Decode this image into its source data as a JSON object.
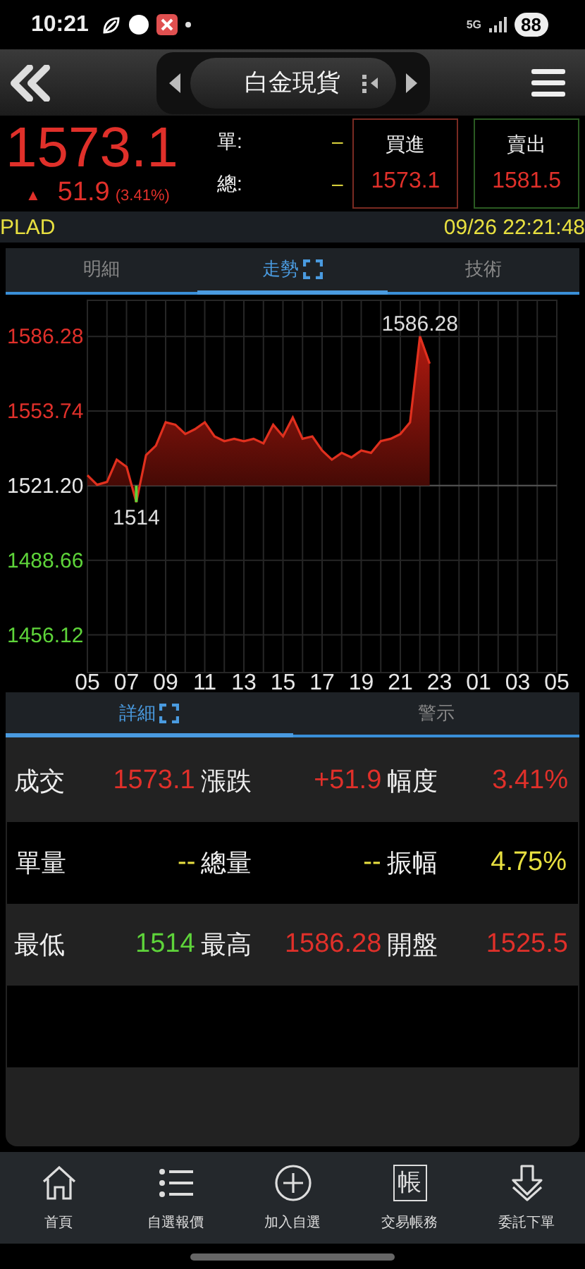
{
  "status_bar": {
    "time": "10:21",
    "network": "5G",
    "battery": "88"
  },
  "header": {
    "title": "白金現貨"
  },
  "quote": {
    "price": "1573.1",
    "arrow": "▲",
    "change": "51.9",
    "change_pct": "(3.41%)",
    "single_label": "單:",
    "single_value": "–",
    "total_label": "總:",
    "total_value": "–",
    "bid": {
      "label": "買進",
      "value": "1573.1"
    },
    "ask": {
      "label": "賣出",
      "value": "1581.5"
    }
  },
  "info_bar": {
    "symbol": "PLAD",
    "datetime": "09/26 22:21:48"
  },
  "tabs": [
    {
      "label": "明細",
      "selected": false,
      "expandable": false
    },
    {
      "label": "走勢",
      "selected": true,
      "expandable": true
    },
    {
      "label": "技術",
      "selected": false,
      "expandable": false
    }
  ],
  "chart_data": {
    "type": "area",
    "categories": [
      "05",
      null,
      null,
      null,
      "07",
      null,
      null,
      null,
      "09",
      null,
      null,
      null,
      "11",
      null,
      null,
      null,
      "13",
      null,
      null,
      null,
      "15",
      null,
      null,
      null,
      "17",
      null,
      null,
      null,
      "19",
      null,
      null,
      null,
      "21",
      null,
      null,
      null,
      "23",
      null,
      null,
      null,
      "01",
      null,
      null,
      null,
      "03",
      null,
      null,
      null,
      "05"
    ],
    "series": [
      {
        "color": "#e0301e",
        "values": [
          1525.7,
          1521.6,
          1522.8,
          1532.5,
          1529.4,
          1514,
          1534.5,
          1538.6,
          1548.8,
          1547.8,
          1543.7,
          1545.8,
          1548.8,
          1542.7,
          1540.6,
          1541.6,
          1540.6,
          1541.6,
          1539.6,
          1547.8,
          1542.7,
          1550.9,
          1541.6,
          1542.7,
          1536.5,
          1532.5,
          1535.5,
          1533.5,
          1536.5,
          1535.5,
          1540.6,
          1541.6,
          1543.7,
          1548.8,
          1586.3,
          1574.4,
          null,
          null,
          null,
          null,
          null,
          null,
          null,
          null,
          null,
          null,
          null,
          null,
          null
        ]
      }
    ],
    "ylim": [
      1439.7,
      1602
    ],
    "yticks": [
      {
        "value": 1586.28,
        "label": "1586.28"
      },
      {
        "value": 1553.74,
        "label": "1553.74"
      },
      {
        "value": 1521.2,
        "label": "1521.20"
      },
      {
        "value": 1488.66,
        "label": "1488.66"
      },
      {
        "value": 1456.12,
        "label": "1456.12"
      }
    ],
    "grid": true,
    "ref_lines": [
      {
        "axis": "y",
        "value": 1521.2
      }
    ],
    "annotations": [
      "1514",
      "1586.28"
    ]
  },
  "detail_tabs": [
    {
      "label": "詳細",
      "selected": true,
      "expandable": true
    },
    {
      "label": "警示",
      "selected": false,
      "expandable": false
    }
  ],
  "details": [
    [
      {
        "label": "成交",
        "value": "1573.1",
        "color": "#e0302a"
      },
      {
        "label": "漲跌",
        "value": "+51.9",
        "color": "#e0302a"
      },
      {
        "label": "幅度",
        "value": "3.41%",
        "color": "#e0302a"
      }
    ],
    [
      {
        "label": "單量",
        "value": "--",
        "color": "#e8e040"
      },
      {
        "label": "總量",
        "value": "--",
        "color": "#e8e040"
      },
      {
        "label": "振幅",
        "value": "4.75%",
        "color": "#e8e040"
      }
    ],
    [
      {
        "label": "最低",
        "value": "1514",
        "color": "#5ed43a"
      },
      {
        "label": "最高",
        "value": "1586.28",
        "color": "#e0302a"
      },
      {
        "label": "開盤",
        "value": "1525.5",
        "color": "#e0302a"
      }
    ]
  ],
  "bottom_nav": [
    {
      "label": "首頁",
      "kind": "home"
    },
    {
      "label": "自選報價",
      "kind": "list"
    },
    {
      "label": "加入自選",
      "kind": "add"
    },
    {
      "label": "交易帳務",
      "kind": "glyph",
      "glyph": "帳"
    },
    {
      "label": "委託下單",
      "kind": "order"
    }
  ]
}
